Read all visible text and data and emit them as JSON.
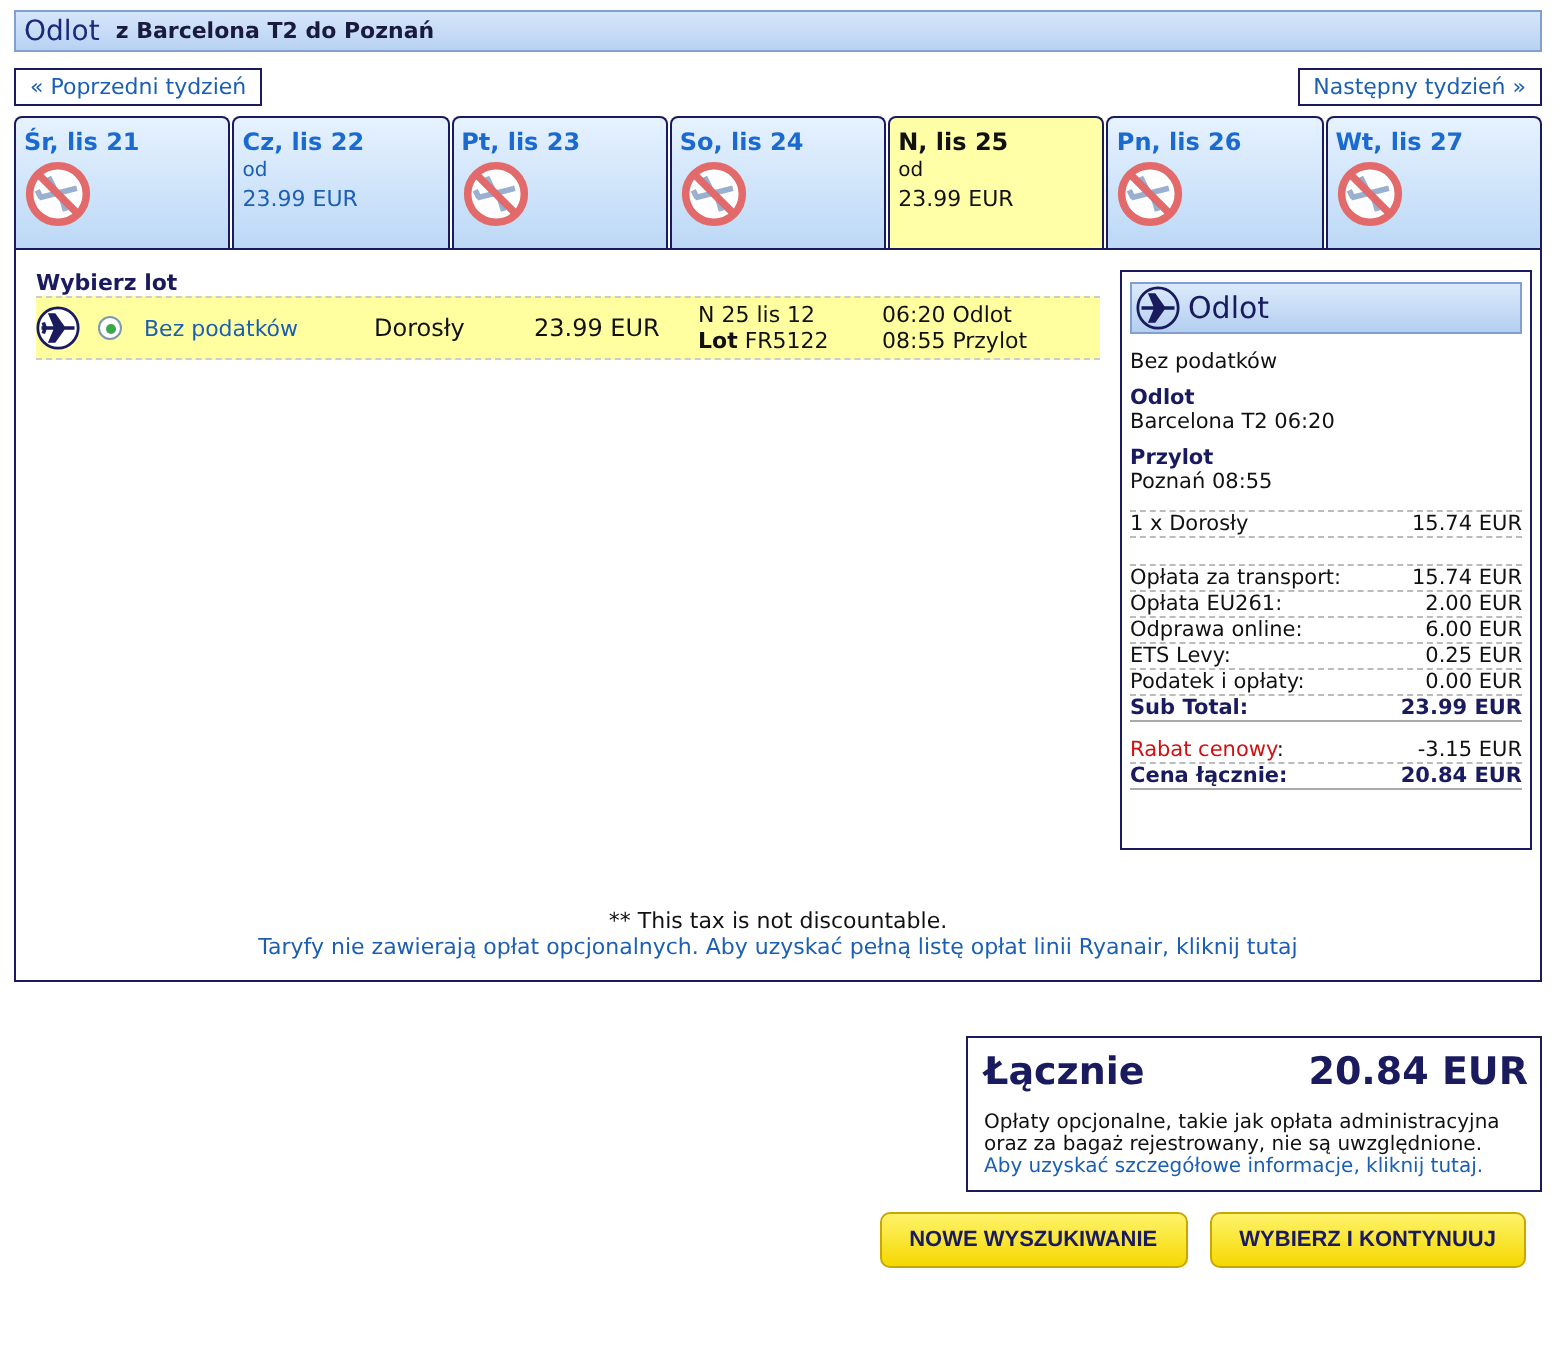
{
  "header": {
    "title": "Odlot",
    "route": "z Barcelona T2 do Poznań"
  },
  "nav": {
    "prev": "« Poprzedni tydzień",
    "next": "Następny tydzień »"
  },
  "days": [
    {
      "label": "Śr, lis 21",
      "selected": false,
      "kind": "none"
    },
    {
      "label": "Cz, lis 22",
      "selected": false,
      "kind": "price",
      "from": "od",
      "price": "23.99 EUR"
    },
    {
      "label": "Pt, lis 23",
      "selected": false,
      "kind": "none"
    },
    {
      "label": "So, lis 24",
      "selected": false,
      "kind": "none"
    },
    {
      "label": "N, lis 25",
      "selected": true,
      "kind": "price",
      "from": "od",
      "price": "23.99 EUR"
    },
    {
      "label": "Pn, lis 26",
      "selected": false,
      "kind": "none"
    },
    {
      "label": "Wt, lis 27",
      "selected": false,
      "kind": "none"
    }
  ],
  "flights": {
    "heading": "Wybierz lot",
    "rows": [
      {
        "selected": true,
        "fare": "Bez podatków",
        "passenger": "Dorosły",
        "price": "23.99 EUR",
        "date": "N 25 lis 12",
        "flight_label": "Lot",
        "flight": "FR5122",
        "dep": "06:20 Odlot",
        "arr": "08:55 Przylot"
      }
    ]
  },
  "summary": {
    "title": "Odlot",
    "fare": "Bez podatków",
    "dep_label": "Odlot",
    "dep": "Barcelona T2 06:20",
    "arr_label": "Przylot",
    "arr": "Poznań 08:55",
    "passenger": {
      "label": "1 x Dorosły",
      "value": "15.74 EUR"
    },
    "lines": [
      {
        "kind": "fee",
        "label": "Opłata za transport:",
        "value": "15.74 EUR"
      },
      {
        "kind": "fee",
        "label": "Opłata EU261:",
        "value": "2.00 EUR"
      },
      {
        "kind": "fee",
        "label": "Odprawa online:",
        "value": "6.00 EUR"
      },
      {
        "kind": "fee",
        "label": "ETS Levy:",
        "value": "0.25 EUR"
      },
      {
        "kind": "fee",
        "label": "Podatek i opłaty:",
        "value": "0.00 EUR"
      },
      {
        "kind": "total",
        "label": "Sub Total:",
        "value": "23.99 EUR"
      },
      {
        "kind": "discount",
        "label": "Rabat cenowy",
        "suffix": ":",
        "value": "-3.15 EUR"
      },
      {
        "kind": "total",
        "label": "Cena łącznie:",
        "value": "20.84 EUR"
      }
    ]
  },
  "notes": {
    "tax": "** This tax is not discountable.",
    "fees_link": "Taryfy nie zawierają opłat opcjonalnych. Aby uzyskać pełną listę opłat linii Ryanair, kliknij tutaj"
  },
  "total": {
    "label": "Łącznie",
    "value": "20.84 EUR",
    "note": "Opłaty opcjonalne, takie jak opłata administracyjna oraz za bagaż rejestrowany, nie są uwzględnione.",
    "link": "Aby uzyskać szczegółowe informacje, kliknij tutaj."
  },
  "buttons": [
    "NOWE WYSZUKIWANIE",
    "WYBIERZ I KONTYNUUJ"
  ]
}
